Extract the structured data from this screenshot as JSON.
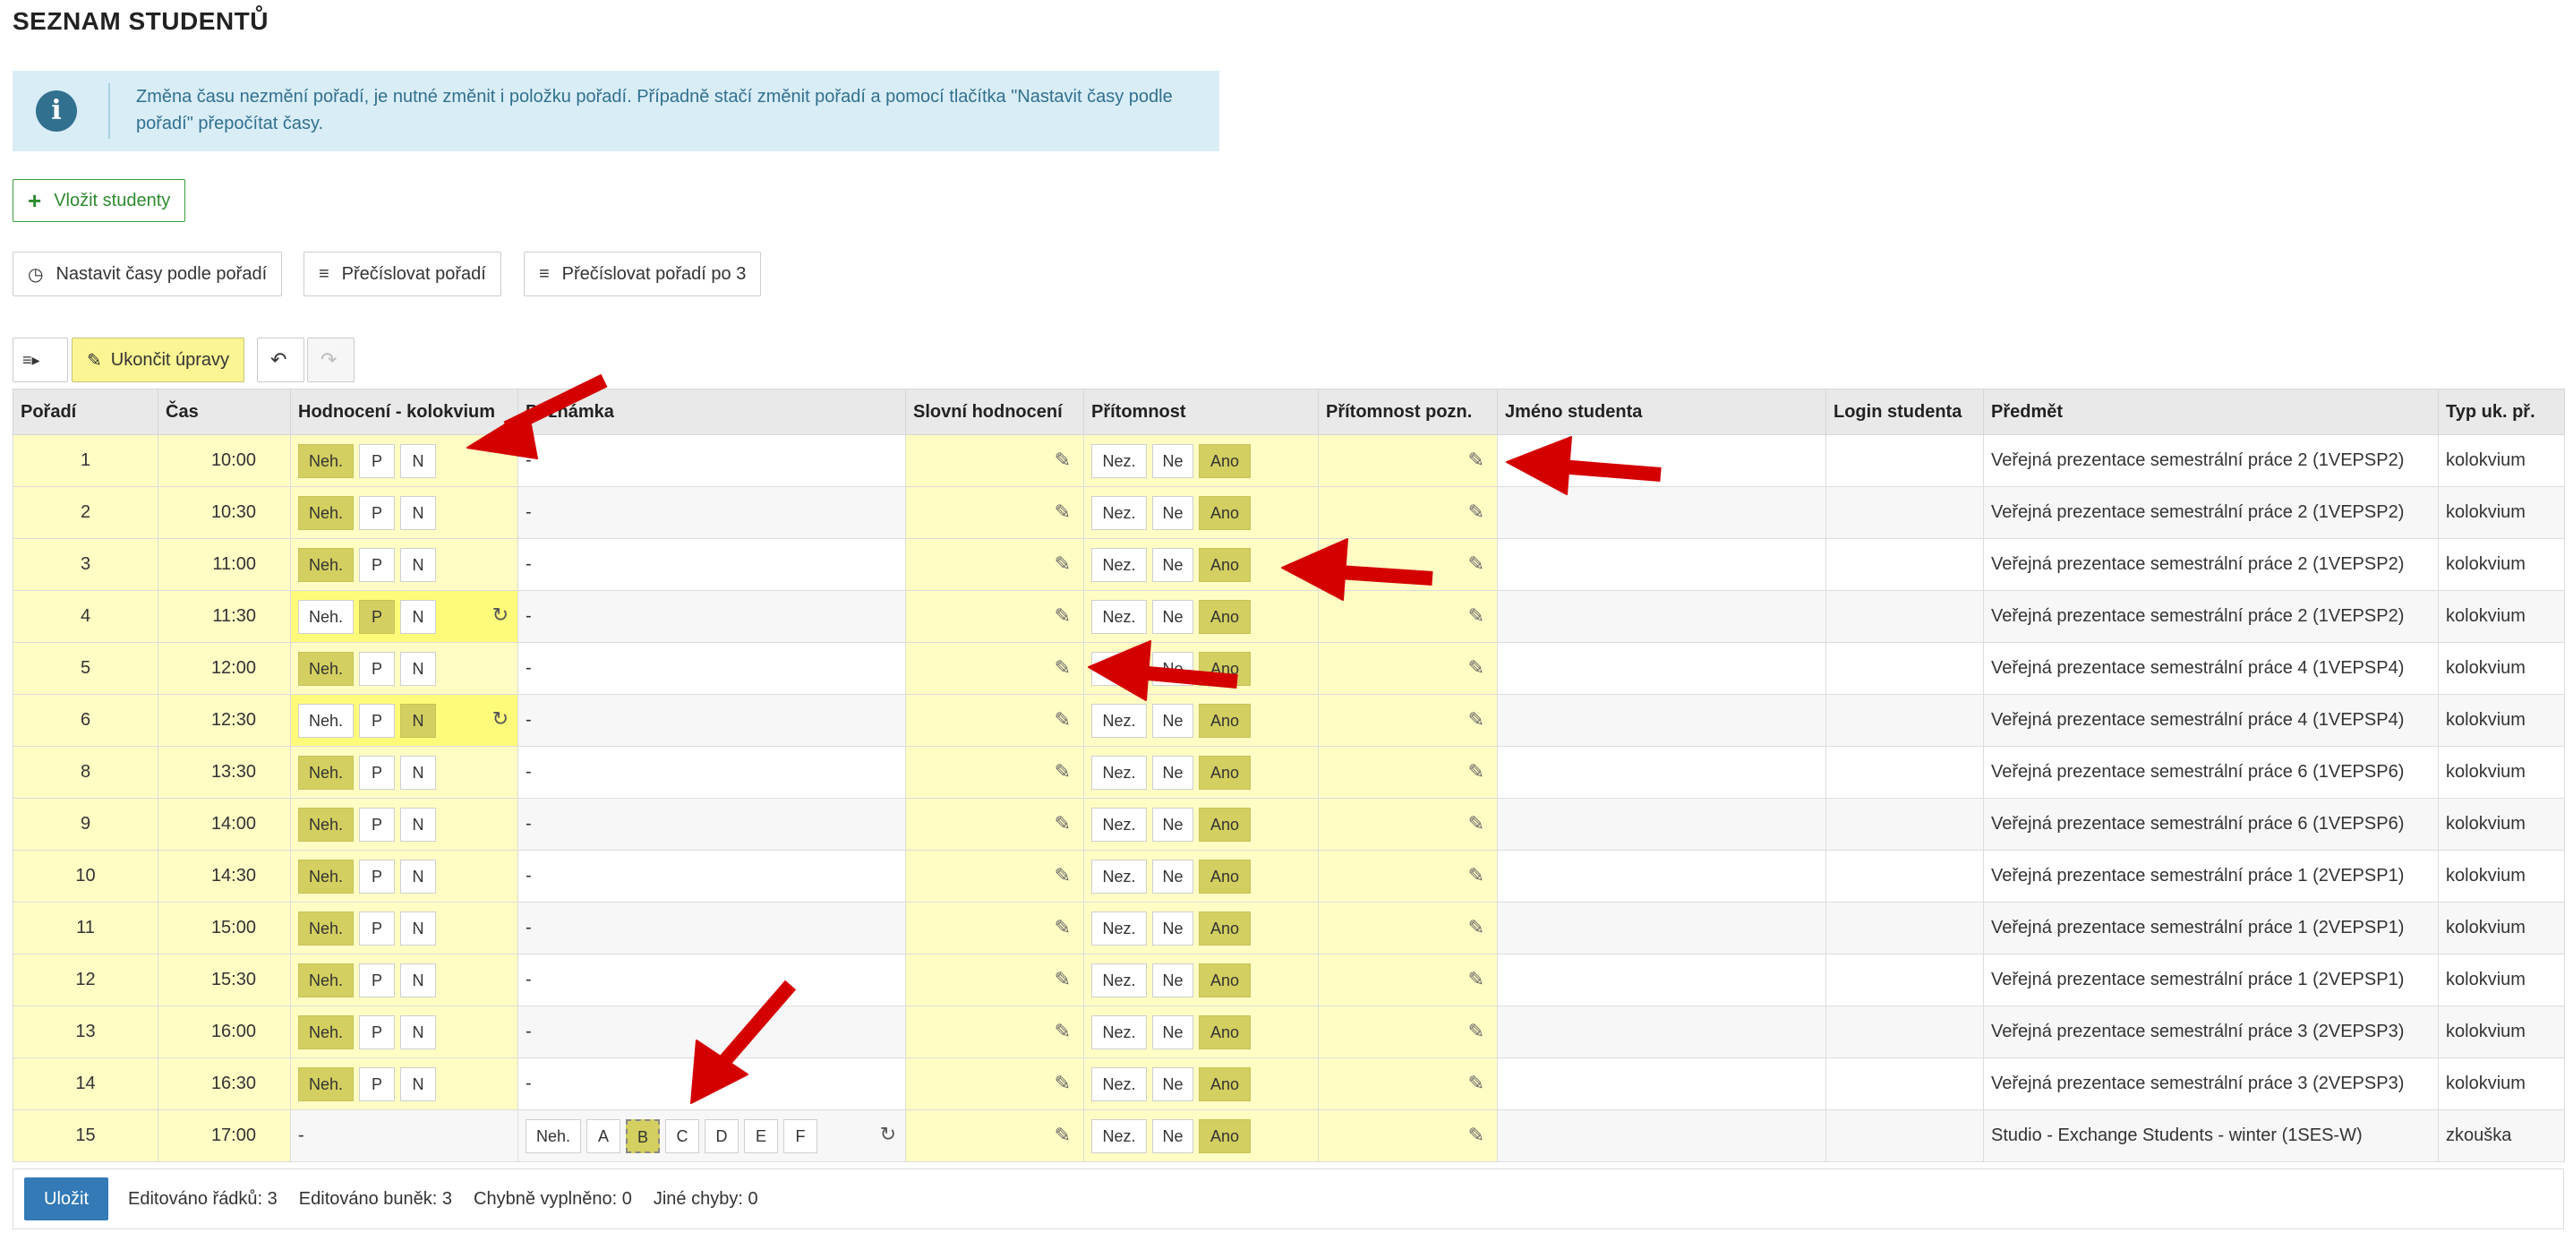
{
  "page_title": "SEZNAM STUDENTŮ",
  "info_text": "Změna času nezmění pořadí, je nutné změnit i položku pořadí. Případně stačí změnit pořadí a pomocí tlačítka \"Nastavit časy podle pořadí\" přepočítat časy.",
  "buttons": {
    "insert_students": "Vložit studenty",
    "set_times": "Nastavit časy podle pořadí",
    "renumber": "Přečíslovat pořadí",
    "renumber_by3": "Přečíslovat pořadí po 3",
    "end_edit": "Ukončit úpravy"
  },
  "columns": [
    "Pořadí",
    "Čas",
    "Hodnocení - kolokvium",
    "Poznámka",
    "Slovní hodnocení",
    "Přítomnost",
    "Přítomnost pozn.",
    "Jméno studenta",
    "Login studenta",
    "Předmět",
    "Typ uk. př."
  ],
  "labels": {
    "neh": "Neh.",
    "p": "P",
    "n": "N",
    "nez": "Nez.",
    "ne": "Ne",
    "ano": "Ano",
    "dash": "-",
    "grades": [
      "A",
      "B",
      "C",
      "D",
      "E",
      "F"
    ]
  },
  "rows": [
    {
      "order": "1",
      "time": "10:00",
      "grade": "Neh.",
      "note": "-",
      "subject": "Veřejná prezentace semestrální práce 2 (1VEPSP2)",
      "type": "kolokvium"
    },
    {
      "order": "2",
      "time": "10:30",
      "grade": "Neh.",
      "note": "-",
      "subject": "Veřejná prezentace semestrální práce 2 (1VEPSP2)",
      "type": "kolokvium"
    },
    {
      "order": "3",
      "time": "11:00",
      "grade": "Neh.",
      "note": "-",
      "subject": "Veřejná prezentace semestrální práce 2 (1VEPSP2)",
      "type": "kolokvium"
    },
    {
      "order": "4",
      "time": "11:30",
      "grade": "P",
      "note": "-",
      "subject": "Veřejná prezentace semestrální práce 2 (1VEPSP2)",
      "type": "kolokvium",
      "edited": true
    },
    {
      "order": "5",
      "time": "12:00",
      "grade": "Neh.",
      "note": "-",
      "subject": "Veřejná prezentace semestrální práce 4 (1VEPSP4)",
      "type": "kolokvium"
    },
    {
      "order": "6",
      "time": "12:30",
      "grade": "N",
      "note": "-",
      "subject": "Veřejná prezentace semestrální práce 4 (1VEPSP4)",
      "type": "kolokvium",
      "edited": true
    },
    {
      "order": "8",
      "time": "13:30",
      "grade": "Neh.",
      "note": "-",
      "subject": "Veřejná prezentace semestrální práce 6 (1VEPSP6)",
      "type": "kolokvium"
    },
    {
      "order": "9",
      "time": "14:00",
      "grade": "Neh.",
      "note": "-",
      "subject": "Veřejná prezentace semestrální práce 6 (1VEPSP6)",
      "type": "kolokvium"
    },
    {
      "order": "10",
      "time": "14:30",
      "grade": "Neh.",
      "note": "-",
      "subject": "Veřejná prezentace semestrální práce 1 (2VEPSP1)",
      "type": "kolokvium"
    },
    {
      "order": "11",
      "time": "15:00",
      "grade": "Neh.",
      "note": "-",
      "subject": "Veřejná prezentace semestrální práce 1 (2VEPSP1)",
      "type": "kolokvium"
    },
    {
      "order": "12",
      "time": "15:30",
      "grade": "Neh.",
      "note": "-",
      "subject": "Veřejná prezentace semestrální práce 1 (2VEPSP1)",
      "type": "kolokvium"
    },
    {
      "order": "13",
      "time": "16:00",
      "grade": "Neh.",
      "note": "-",
      "subject": "Veřejná prezentace semestrální práce 3 (2VEPSP3)",
      "type": "kolokvium"
    },
    {
      "order": "14",
      "time": "16:30",
      "grade": "Neh.",
      "note": "-",
      "subject": "Veřejná prezentace semestrální práce 3 (2VEPSP3)",
      "type": "kolokvium"
    },
    {
      "order": "15",
      "time": "17:00",
      "grade": "-",
      "note_grade": "B",
      "subject": "Studio - Exchange Students - winter (1SES-W)",
      "type": "zkouška",
      "exam": true
    }
  ],
  "footer": {
    "save": "Uložit",
    "edited_rows": "Editováno řádků: 3",
    "edited_cells": "Editováno buněk: 3",
    "wrong": "Chybně vyplněno: 0",
    "other": "Jiné chyby: 0"
  },
  "colors": {
    "annotation_arrow": "#d40000",
    "selected_choice": "#d3cf60",
    "info_bg": "#d9edf7"
  }
}
